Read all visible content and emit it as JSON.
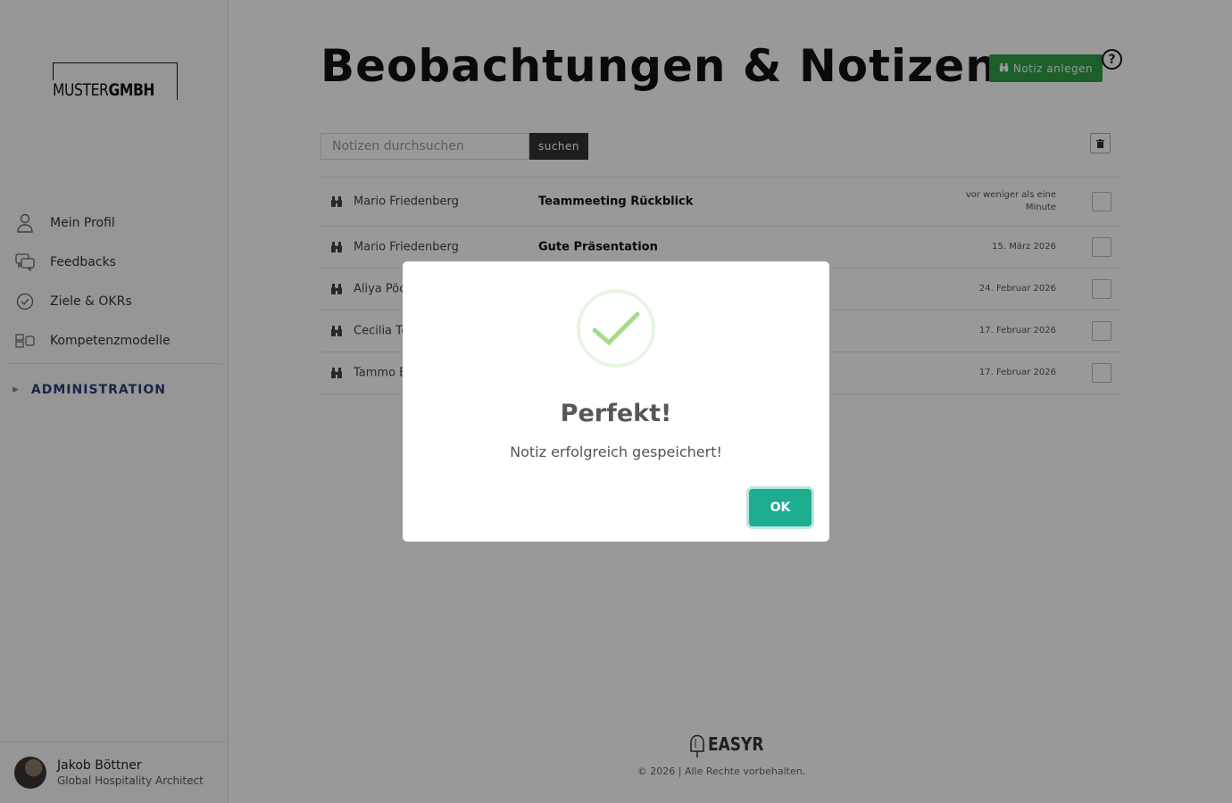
{
  "sidebar": {
    "logo": {
      "light": "MUSTER",
      "bold": "GMBH"
    },
    "items": [
      {
        "label": "Mein Profil",
        "icon": "user-icon"
      },
      {
        "label": "Feedbacks",
        "icon": "chat-icon"
      },
      {
        "label": "Ziele & OKRs",
        "icon": "check-circle-icon"
      },
      {
        "label": "Kompetenzmodelle",
        "icon": "model-icon"
      }
    ],
    "admin_label": "ADMINISTRATION",
    "user": {
      "name": "Jakob Böttner",
      "role": "Global Hospitality Architect"
    }
  },
  "main": {
    "title": "Beobachtungen & Notizen",
    "new_button": "Notiz anlegen",
    "help": "?",
    "search": {
      "placeholder": "Notizen durchsuchen",
      "value": "",
      "button": "suchen"
    },
    "rows": [
      {
        "author": "Mario Friedenberg",
        "title": "Teammeeting Rückblick",
        "date": "vor weniger als eine Minute"
      },
      {
        "author": "Mario Friedenberg",
        "title": "Gute Präsentation",
        "date": "15. März 2026"
      },
      {
        "author": "Aliya Pöch",
        "title": "",
        "date": "24. Februar 2026"
      },
      {
        "author": "Cecilia Tö",
        "title": "",
        "date": "17. Februar 2026"
      },
      {
        "author": "Tammo E",
        "title": "",
        "date": "17. Februar 2026"
      }
    ]
  },
  "footer": {
    "brand": "EASYR",
    "copyright": "© 2026 | Alle Rechte vorbehalten."
  },
  "modal": {
    "title": "Perfekt!",
    "text": "Notiz erfolgreich gespeichert!",
    "ok": "OK"
  },
  "colors": {
    "accent_green": "#2e9e46",
    "ok_teal": "#1fad92",
    "admin_blue": "#2a3f7a",
    "success_check": "#a5dc86"
  }
}
